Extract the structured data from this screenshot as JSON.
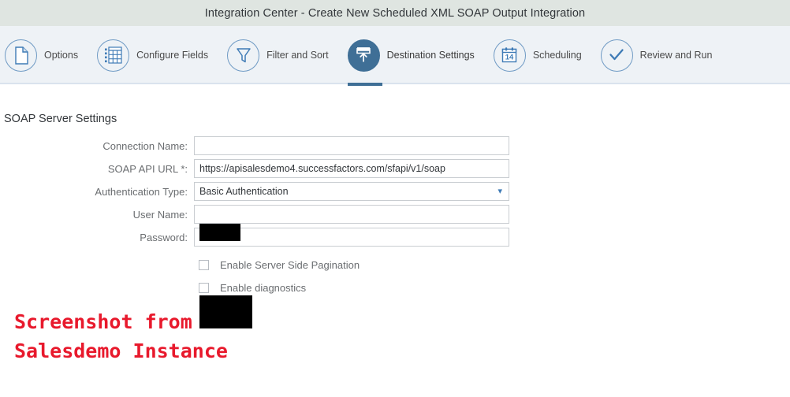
{
  "window": {
    "title": "Integration Center - Create New Scheduled XML SOAP Output Integration"
  },
  "wizard": {
    "steps": [
      {
        "label": "Options",
        "icon": "document-icon",
        "active": false
      },
      {
        "label": "Configure Fields",
        "icon": "grid-table-icon",
        "active": false
      },
      {
        "label": "Filter and Sort",
        "icon": "funnel-filter-icon",
        "active": false
      },
      {
        "label": "Destination Settings",
        "icon": "upload-export-icon",
        "active": true
      },
      {
        "label": "Scheduling",
        "icon": "calendar-icon",
        "active": false
      },
      {
        "label": "Review and Run",
        "icon": "checkmark-icon",
        "active": false
      }
    ],
    "calendar_day": "14",
    "active_color": "#3f6f96",
    "outline_color": "#6f9ac4"
  },
  "main": {
    "section_title": "SOAP Server Settings",
    "fields": [
      {
        "label": "Connection Name:",
        "value": "",
        "type": "text",
        "redacted": true
      },
      {
        "label": "SOAP API URL *:",
        "value": "https://apisalesdemo4.successfactors.com/sfapi/v1/soap",
        "type": "text",
        "redacted": false
      },
      {
        "label": "Authentication Type:",
        "value": "Basic Authentication",
        "type": "select",
        "redacted": false
      },
      {
        "label": "User Name:",
        "value": "",
        "type": "text",
        "redacted": true
      },
      {
        "label": "Password:",
        "value": "",
        "type": "password",
        "redacted": true
      }
    ],
    "checkboxes": [
      {
        "label": "Enable Server Side Pagination",
        "checked": false
      },
      {
        "label": "Enable diagnostics",
        "checked": false
      }
    ]
  },
  "annotation": {
    "line1": "Screenshot from",
    "line2": "Salesdemo Instance",
    "color": "#e8192c"
  }
}
